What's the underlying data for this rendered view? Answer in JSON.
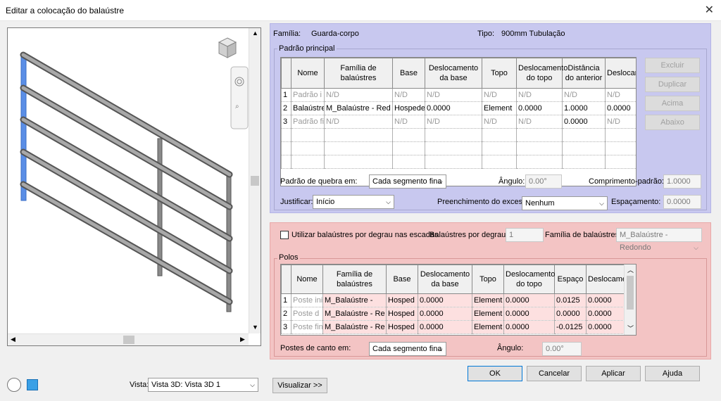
{
  "window": {
    "title": "Editar a colocação do balaústre"
  },
  "header": {
    "familia_label": "Família:",
    "familia_value": "Guarda-corpo",
    "tipo_label": "Tipo:",
    "tipo_value": "900mm Tubulação"
  },
  "main_pattern": {
    "group_label": "Padrão principal",
    "columns": [
      "",
      "Nome",
      "Família de balaústres",
      "Base",
      "Deslocamento da base",
      "Topo",
      "Deslocamento do topo",
      "Distância do anterior",
      "Deslocamento"
    ],
    "rows": [
      [
        "1",
        "Padrão i",
        "N/D",
        "N/D",
        "N/D",
        "N/D",
        "N/D",
        "N/D",
        "N/D"
      ],
      [
        "2",
        "Balaústre",
        "M_Balaústre - Red",
        "Hospede",
        "0.0000",
        "Element",
        "0.0000",
        "1.0000",
        "0.0000"
      ],
      [
        "3",
        "Padrão fi",
        "N/D",
        "N/D",
        "N/D",
        "N/D",
        "N/D",
        "0.0000",
        "N/D"
      ]
    ],
    "buttons": {
      "excluir": "Excluir",
      "duplicar": "Duplicar",
      "acima": "Acima",
      "abaixo": "Abaixo"
    },
    "break_label": "Padrão de quebra em:",
    "break_value": "Cada segmento fina",
    "angle_label": "Ângulo:",
    "angle_value": "0.00°",
    "length_label": "Comprimento-padrão:",
    "length_value": "1.0000",
    "justify_label": "Justificar:",
    "justify_value": "Início",
    "excess_label": "Preenchimento do excesso",
    "excess_value": "Nenhum",
    "spacing_label": "Espaçamento:",
    "spacing_value": "0.0000"
  },
  "stairs": {
    "checkbox_label": "Utilizar balaústres por degrau nas escadas",
    "per_tread_label": "Balaústres por degrau:",
    "per_tread_value": "1",
    "family_label": "Família de balaústres:",
    "family_value": "M_Balaústre - Redondo"
  },
  "posts": {
    "group_label": "Polos",
    "columns": [
      "",
      "Nome",
      "Família de balaústres",
      "Base",
      "Deslocamento da base",
      "Topo",
      "Deslocamento do topo",
      "Espaço",
      "Deslocamento"
    ],
    "rows": [
      [
        "1",
        "Poste ini",
        "M_Balaústre -",
        "Hosped",
        "0.0000",
        "Element",
        "0.0000",
        "0.0125",
        "0.0000"
      ],
      [
        "2",
        "Poste d",
        "M_Balaústre - Re",
        "Hosped",
        "0.0000",
        "Element",
        "0.0000",
        "0.0000",
        "0.0000"
      ],
      [
        "3",
        "Poste fin",
        "M_Balaústre - Re",
        "Hosped",
        "0.0000",
        "Element",
        "0.0000",
        "-0.0125",
        "0.0000"
      ]
    ],
    "corner_label": "Postes de canto em:",
    "corner_value": "Cada segmento fina",
    "angle_label": "Ângulo:",
    "angle_value": "0.00°"
  },
  "footer": {
    "vista_label": "Vista:",
    "vista_value": "Vista 3D: Vista 3D 1",
    "preview_button": "Visualizar >>",
    "ok": "OK",
    "cancel": "Cancelar",
    "apply": "Aplicar",
    "help": "Ajuda"
  },
  "colors": {
    "blue_panel": "#c8c8ef",
    "red_panel": "#f3c4c4",
    "accent": "#0078d7"
  }
}
